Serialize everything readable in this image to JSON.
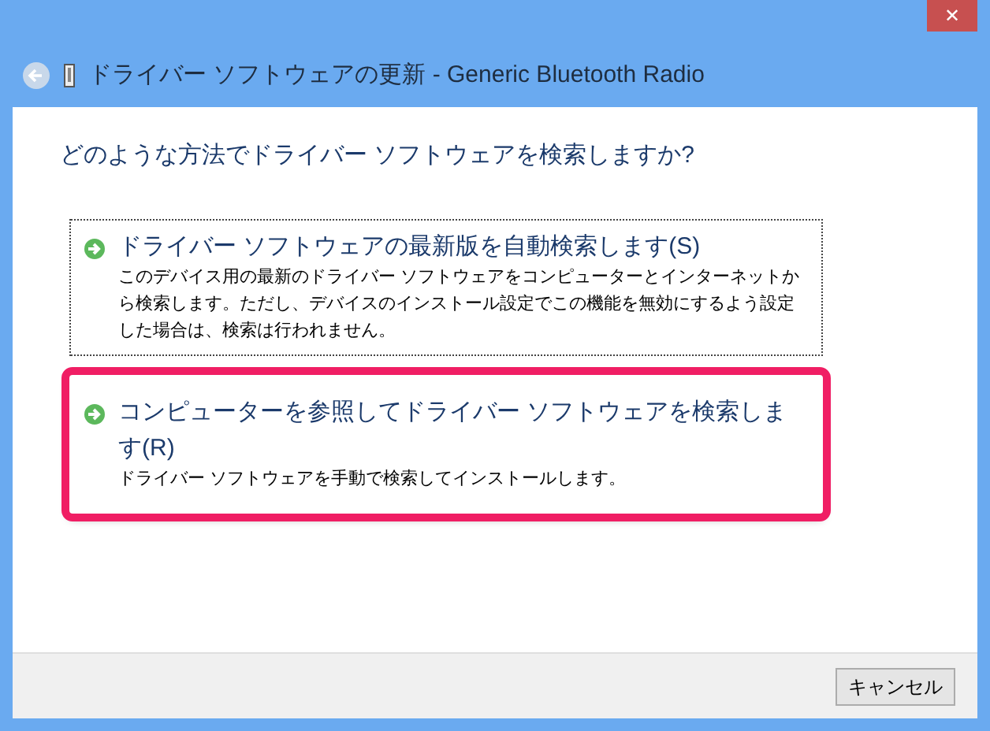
{
  "window": {
    "title": "ドライバー ソフトウェアの更新 - Generic Bluetooth Radio",
    "close": "✕"
  },
  "question": "どのような方法でドライバー ソフトウェアを検索しますか?",
  "options": [
    {
      "title": "ドライバー ソフトウェアの最新版を自動検索します(S)",
      "description": "このデバイス用の最新のドライバー ソフトウェアをコンピューターとインターネットから検索します。ただし、デバイスのインストール設定でこの機能を無効にするよう設定した場合は、検索は行われません。",
      "focused": true,
      "highlighted": false
    },
    {
      "title": "コンピューターを参照してドライバー ソフトウェアを検索します(R)",
      "description": "ドライバー ソフトウェアを手動で検索してインストールします。",
      "focused": false,
      "highlighted": true
    }
  ],
  "buttons": [
    "キャンセル"
  ]
}
